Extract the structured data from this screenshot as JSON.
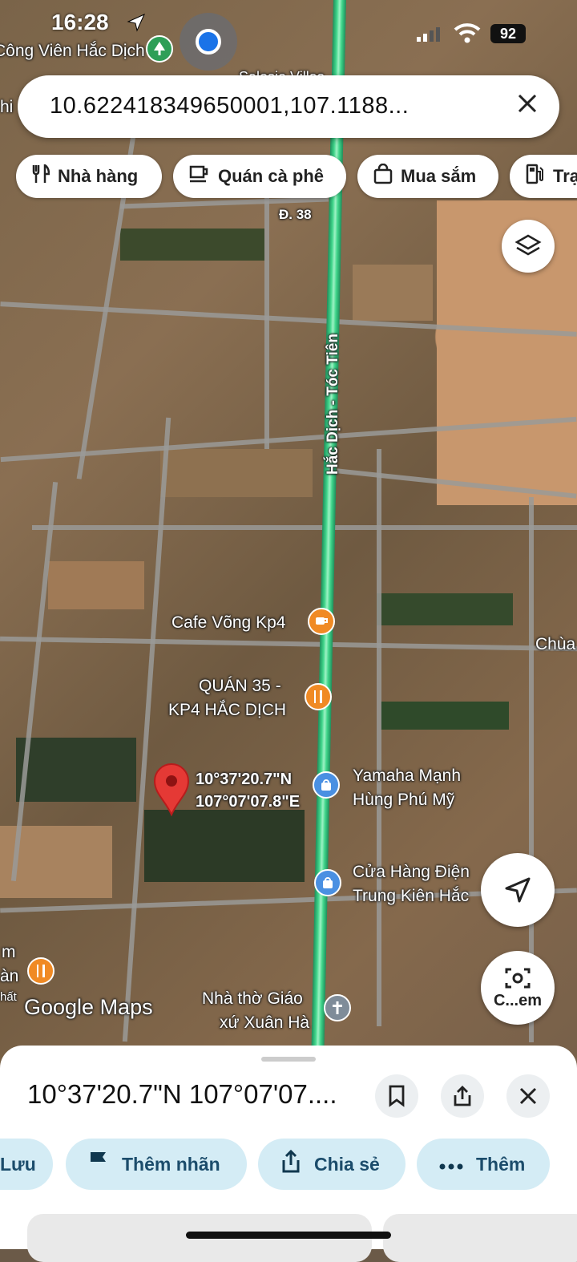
{
  "status_bar": {
    "time": "16:28",
    "battery": "92"
  },
  "search": {
    "value": "10.622418349650001,107.1188..."
  },
  "chips": [
    {
      "label": "Nhà hàng",
      "icon": "fork-knife-icon"
    },
    {
      "label": "Quán cà phê",
      "icon": "coffee-cup-icon"
    },
    {
      "label": "Mua sắm",
      "icon": "shopping-bag-icon"
    },
    {
      "label": "Trạ",
      "icon": "gas-station-icon"
    }
  ],
  "map": {
    "top_labels": {
      "park": "Công Viên Hắc Dịch",
      "villa": "Salosio Villas",
      "left_edge": "hi"
    },
    "road_labels": {
      "d38": "Đ. 38",
      "main_road": "Hắc Dịch - Tóc Tiên"
    },
    "places": {
      "cafe": "Cafe Võng Kp4",
      "quan35_line1": "QUÁN 35 -",
      "quan35_line2": "KP4 HẮC DỊCH",
      "chua": "Chùa",
      "yamaha_line1": "Yamaha Mạnh",
      "yamaha_line2": "Hùng Phú Mỹ",
      "cuahang_line1": "Cửa Hàng Điện",
      "cuahang_line2": "Trung Kiên Hắc",
      "nhatho_line1": "Nhà thờ Giáo",
      "nhatho_line2": "xứ Xuân Hà",
      "left_fragment_1": "m",
      "left_fragment_2": "àn",
      "left_fragment_3": "hất"
    },
    "pin": {
      "lat": "10°37'20.7\"N",
      "lng": "107°07'07.8\"E"
    },
    "watermark": "Google Maps",
    "camera_label": "C...em",
    "accent_green": "#3fd58a",
    "pin_red": "#e53935"
  },
  "sheet": {
    "title": "10°37'20.7\"N 107°07'07....",
    "actions": [
      {
        "label": "Lưu",
        "icon": "bookmark-icon"
      },
      {
        "label": "Thêm nhãn",
        "icon": "flag-icon"
      },
      {
        "label": "Chia sẻ",
        "icon": "share-icon"
      },
      {
        "label": "Thêm",
        "icon": "more-dots-icon"
      }
    ]
  }
}
